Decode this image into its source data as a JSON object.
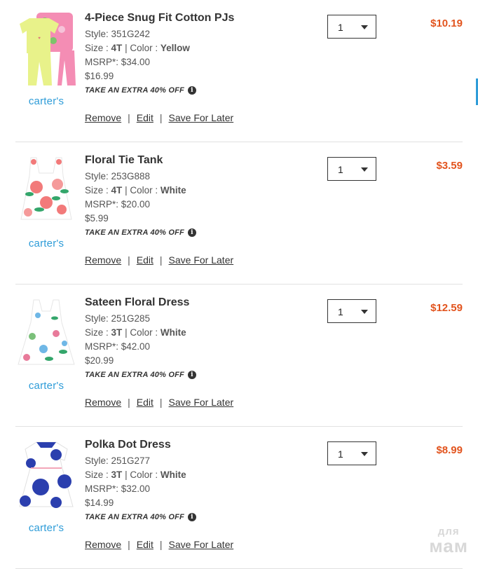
{
  "colors": {
    "price": "#e2541e",
    "brand": "#2e9cd8"
  },
  "items": [
    {
      "name": "4-Piece Snug Fit Cotton PJs",
      "style": "Style: 351G242",
      "size_label": "Size :",
      "size": "4T",
      "color_label": "| Color :",
      "color": "Yellow",
      "msrp": "MSRP*: $34.00",
      "price_line": "$16.99",
      "promo": "TAKE AN EXTRA 40% OFF",
      "brand": "carter's",
      "qty": "1",
      "total": "$10.19",
      "remove": "Remove",
      "edit": "Edit",
      "save": "Save For Later",
      "image": "pajama-set-image"
    },
    {
      "name": "Floral Tie Tank",
      "style": "Style: 253G888",
      "size_label": "Size :",
      "size": "4T",
      "color_label": "| Color :",
      "color": "White",
      "msrp": "MSRP*: $20.00",
      "price_line": "$5.99",
      "promo": "TAKE AN EXTRA 40% OFF",
      "brand": "carter's",
      "qty": "1",
      "total": "$3.59",
      "remove": "Remove",
      "edit": "Edit",
      "save": "Save For Later",
      "image": "floral-tank-image"
    },
    {
      "name": "Sateen Floral Dress",
      "style": "Style: 251G285",
      "size_label": "Size :",
      "size": "3T",
      "color_label": "| Color :",
      "color": "White",
      "msrp": "MSRP*: $42.00",
      "price_line": "$20.99",
      "promo": "TAKE AN EXTRA 40% OFF",
      "brand": "carter's",
      "qty": "1",
      "total": "$12.59",
      "remove": "Remove",
      "edit": "Edit",
      "save": "Save For Later",
      "image": "floral-dress-image"
    },
    {
      "name": "Polka Dot Dress",
      "style": "Style: 251G277",
      "size_label": "Size :",
      "size": "3T",
      "color_label": "| Color :",
      "color": "White",
      "msrp": "MSRP*: $32.00",
      "price_line": "$14.99",
      "promo": "TAKE AN EXTRA 40% OFF",
      "brand": "carter's",
      "qty": "1",
      "total": "$8.99",
      "remove": "Remove",
      "edit": "Edit",
      "save": "Save For Later",
      "image": "polka-dot-dress-image"
    }
  ],
  "separator": "|",
  "info_icon": "info-icon",
  "watermark": {
    "line1": "для",
    "line2": "мам"
  }
}
